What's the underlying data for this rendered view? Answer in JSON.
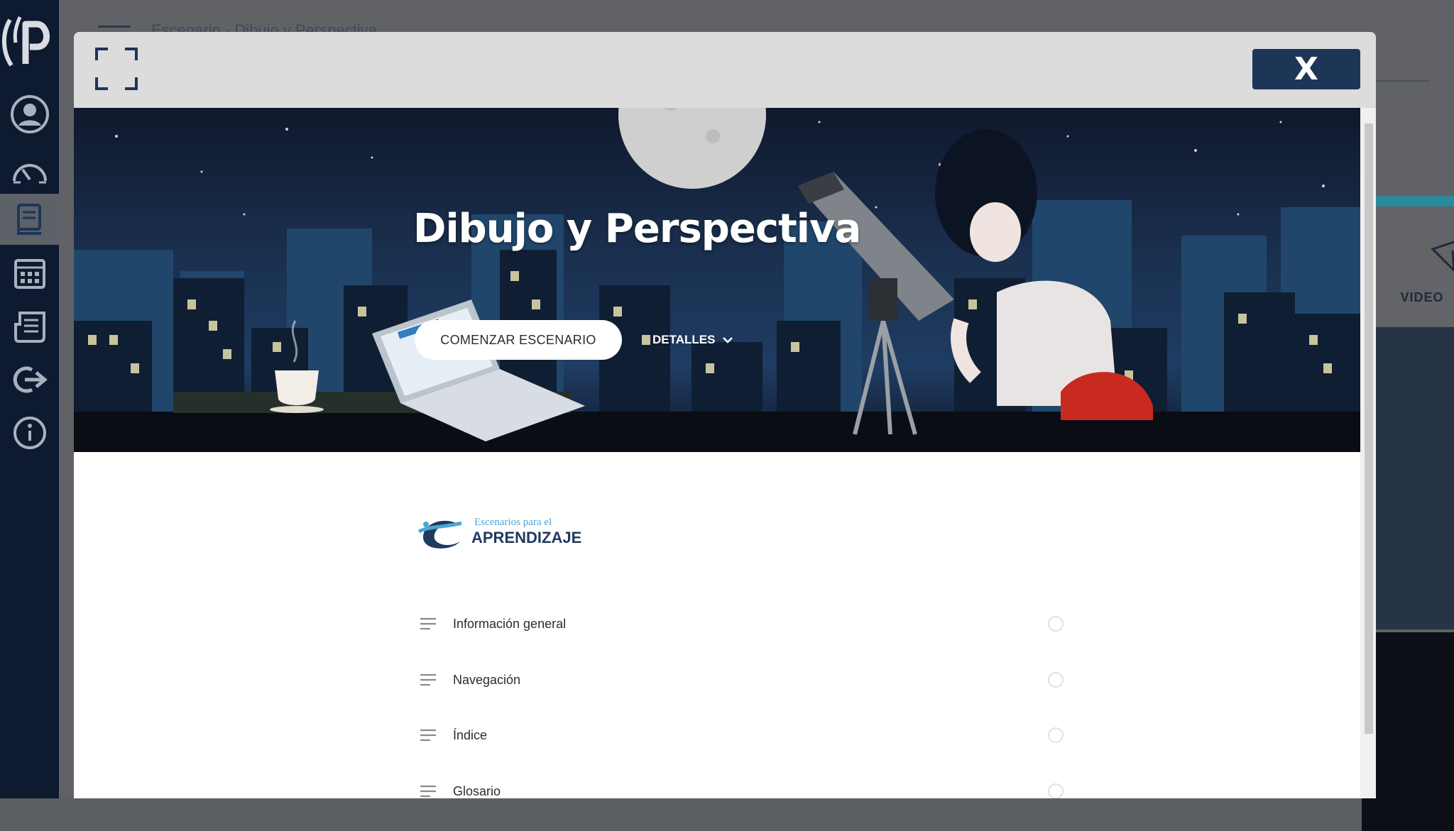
{
  "app": {
    "page_heading": "Escenario · Dibujo y Perspectiva",
    "bg_card_label": "VIDEO"
  },
  "sidebar": {
    "items": [
      {
        "name": "profile",
        "icon": "user-circle-icon"
      },
      {
        "name": "dashboard",
        "icon": "speedometer-icon"
      },
      {
        "name": "courses",
        "icon": "book-icon",
        "active": true
      },
      {
        "name": "calendar",
        "icon": "calendar-icon"
      },
      {
        "name": "news",
        "icon": "newspaper-icon"
      },
      {
        "name": "logout",
        "icon": "logout-icon"
      },
      {
        "name": "info",
        "icon": "info-icon"
      }
    ]
  },
  "modal": {
    "close_label": "X",
    "banner": {
      "title": "Dibujo y Perspectiva",
      "start_button": "COMENZAR ESCENARIO",
      "details_label": "DETALLES"
    },
    "brand": {
      "small": "Escenarios para el",
      "big": "APRENDIZAJE"
    },
    "toc": [
      {
        "label": "Información general"
      },
      {
        "label": "Navegación"
      },
      {
        "label": "Índice"
      },
      {
        "label": "Glosario"
      }
    ]
  },
  "colors": {
    "sidebar_bg": "#0d1a30",
    "close_button": "#1d3557",
    "brand_dark": "#1f3a5f",
    "brand_light": "#4aa7d6"
  }
}
